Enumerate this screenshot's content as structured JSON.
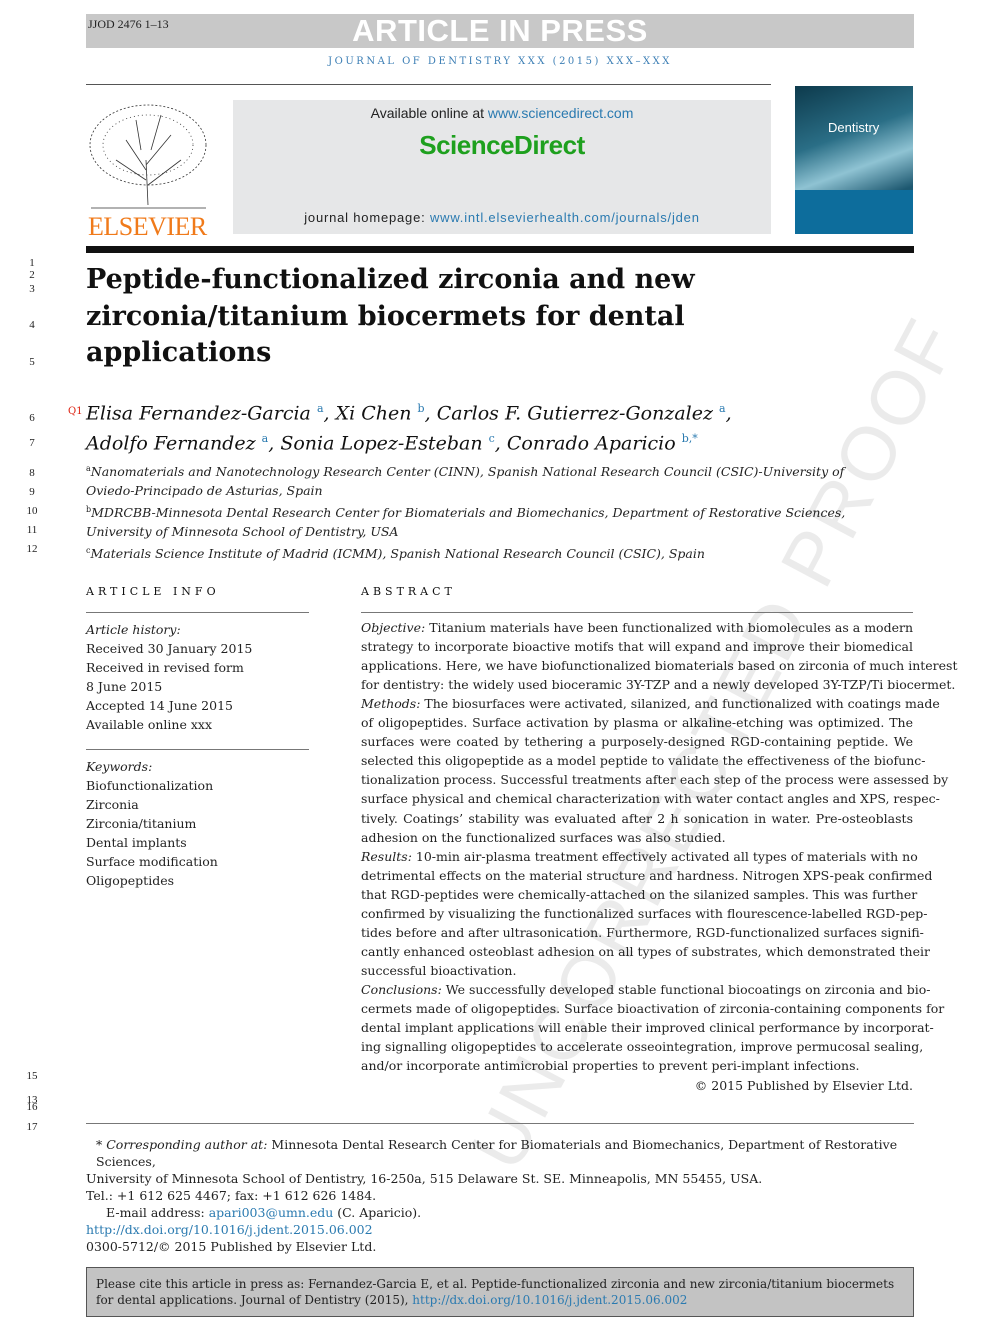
{
  "header": {
    "journal_id": "JJOD 2476 1–13",
    "banner": "ARTICLE IN PRESS",
    "journal_line": "JOURNAL OF DENTISTRY XXX (2015) XXX–XXX"
  },
  "publisher": {
    "logo_text": "ELSEVIER",
    "available_prefix": "Available online at ",
    "available_link": "www.sciencedirect.com",
    "brand": "ScienceDirect",
    "homepage_prefix": "journal homepage: ",
    "homepage_link": "www.intl.elsevierhealth.com/journals/jden",
    "cover_title": "Dentistry"
  },
  "watermark": "UNCORRECTED PROOF",
  "line_numbers": [
    "1",
    "2",
    "3",
    "4",
    "5",
    "6",
    "7",
    "8",
    "9",
    "10",
    "11",
    "12",
    "15",
    "13",
    "16",
    "17"
  ],
  "title_lines": [
    "Peptide-functionalized zirconia and new",
    "zirconia/titanium biocermets for dental",
    "applications"
  ],
  "query_mark": "Q1",
  "authors": [
    [
      {
        "name": "Elisa Fernandez-Garcia",
        "sup": "a"
      },
      {
        "name": "Xi Chen",
        "sup": "b"
      },
      {
        "name": "Carlos F. Gutierrez-Gonzalez",
        "sup": "a"
      }
    ],
    [
      {
        "name": "Adolfo Fernandez",
        "sup": "a"
      },
      {
        "name": "Sonia Lopez-Esteban",
        "sup": "c"
      },
      {
        "name": "Conrado Aparicio",
        "sup": "b,*"
      }
    ]
  ],
  "affiliations": [
    {
      "sup": "a",
      "line1": "Nanomaterials and Nanotechnology Research Center (CINN), Spanish National Research Council (CSIC)-University of",
      "line2": "Oviedo-Principado de Asturias, Spain"
    },
    {
      "sup": "b",
      "line1": "MDRCBB-Minnesota Dental Research Center for Biomaterials and Biomechanics, Department of Restorative Sciences,",
      "line2": "University of Minnesota School of Dentistry, USA"
    },
    {
      "sup": "c",
      "line1": "Materials Science Institute of Madrid (ICMM), Spanish National Research Council (CSIC), Spain",
      "line2": ""
    }
  ],
  "article_info": {
    "heading": "ARTICLE INFO",
    "history_label": "Article history:",
    "history": [
      "Received 30 January 2015",
      "Received in revised form",
      "8 June 2015",
      "Accepted 14 June 2015",
      "Available online xxx"
    ],
    "keywords_label": "Keywords:",
    "keywords": [
      "Biofunctionalization",
      "Zirconia",
      "Zirconia/titanium",
      "Dental implants",
      "Surface modification",
      "Oligopeptides"
    ]
  },
  "abstract": {
    "heading": "ABSTRACT",
    "lines": [
      {
        "label": "Objective:",
        "text": " Titanium materials have been functionalized with biomolecules as a modern"
      },
      {
        "text": "strategy to incorporate bioactive motifs that will expand and improve their biomedical"
      },
      {
        "text": "applications. Here, we have biofunctionalized biomaterials based on zirconia of much interest"
      },
      {
        "text": "for dentistry: the widely used bioceramic 3Y-TZP and a newly developed 3Y-TZP/Ti biocermet."
      },
      {
        "label": "Methods:",
        "text": " The biosurfaces were activated, silanized, and functionalized with coatings made"
      },
      {
        "text": "of oligopeptides. Surface activation by plasma or alkaline-etching was optimized. The"
      },
      {
        "text": "surfaces were coated by tethering a purposely-designed RGD-containing peptide. We"
      },
      {
        "text": "selected this oligopeptide as a model peptide to validate the effectiveness of the biofunc-"
      },
      {
        "text": "tionalization process. Successful treatments after each step of the process were assessed by"
      },
      {
        "text": "surface physical and chemical characterization with water contact angles and XPS, respec-"
      },
      {
        "text": "tively. Coatings’ stability was evaluated after 2 h sonication in water. Pre-osteoblasts"
      },
      {
        "text": "adhesion on the functionalized surfaces was also studied.",
        "last": true
      },
      {
        "label": "Results:",
        "text": " 10-min air-plasma treatment effectively activated all types of materials with no"
      },
      {
        "text": "detrimental effects on the material structure and hardness. Nitrogen XPS-peak confirmed"
      },
      {
        "text": "that RGD-peptides were chemically-attached on the silanized samples. This was further"
      },
      {
        "text": "confirmed by visualizing the functionalized surfaces with flourescence-labelled RGD-pep-"
      },
      {
        "text": "tides before and after ultrasonication. Furthermore, RGD-functionalized surfaces signifi-"
      },
      {
        "text": "cantly enhanced osteoblast adhesion on all types of substrates, which demonstrated their"
      },
      {
        "text": "successful bioactivation.",
        "last": true
      },
      {
        "label": "Conclusions:",
        "text": " We successfully developed stable functional biocoatings on zirconia and bio-"
      },
      {
        "text": "cermets made of oligopeptides. Surface bioactivation of zirconia-containing components for"
      },
      {
        "text": "dental implant applications will enable their improved clinical performance by incorporat-"
      },
      {
        "text": "ing signalling oligopeptides to accelerate osseointegration, improve permucosal sealing,"
      },
      {
        "text": "and/or incorporate antimicrobial properties to prevent peri-implant infections.",
        "last": true
      }
    ],
    "copyright": "© 2015 Published by Elsevier Ltd."
  },
  "footnotes": {
    "corr_label": "* Corresponding author at:",
    "corr_text": " Minnesota Dental Research Center for Biomaterials and Biomechanics, Department of Restorative Sciences,",
    "corr_line2": "University of Minnesota School of Dentistry, 16-250a, 515 Delaware St. SE. Minneapolis, MN 55455, USA.",
    "tel": "Tel.: +1 612 625 4467; fax: +1 612 626 1484.",
    "email_prefix": "E-mail address: ",
    "email": "apari003@umn.edu",
    "email_suffix": " (C. Aparicio).",
    "doi": "http://dx.doi.org/10.1016/j.jdent.2015.06.002",
    "issn": "0300-5712/© 2015 Published by Elsevier Ltd."
  },
  "citation": {
    "text": "Please cite this article in press as: Fernandez-Garcia E, et al. Peptide-functionalized zirconia and new zirconia/titanium biocermets for dental applications. Journal of Dentistry (2015), ",
    "doi": "http://dx.doi.org/10.1016/j.jdent.2015.06.002"
  },
  "colors": {
    "link": "#2a7ab0",
    "elsevier_orange": "#f07a1a",
    "sciencedirect_green": "#1ea01e",
    "banner_gray": "#c8c8c8"
  }
}
